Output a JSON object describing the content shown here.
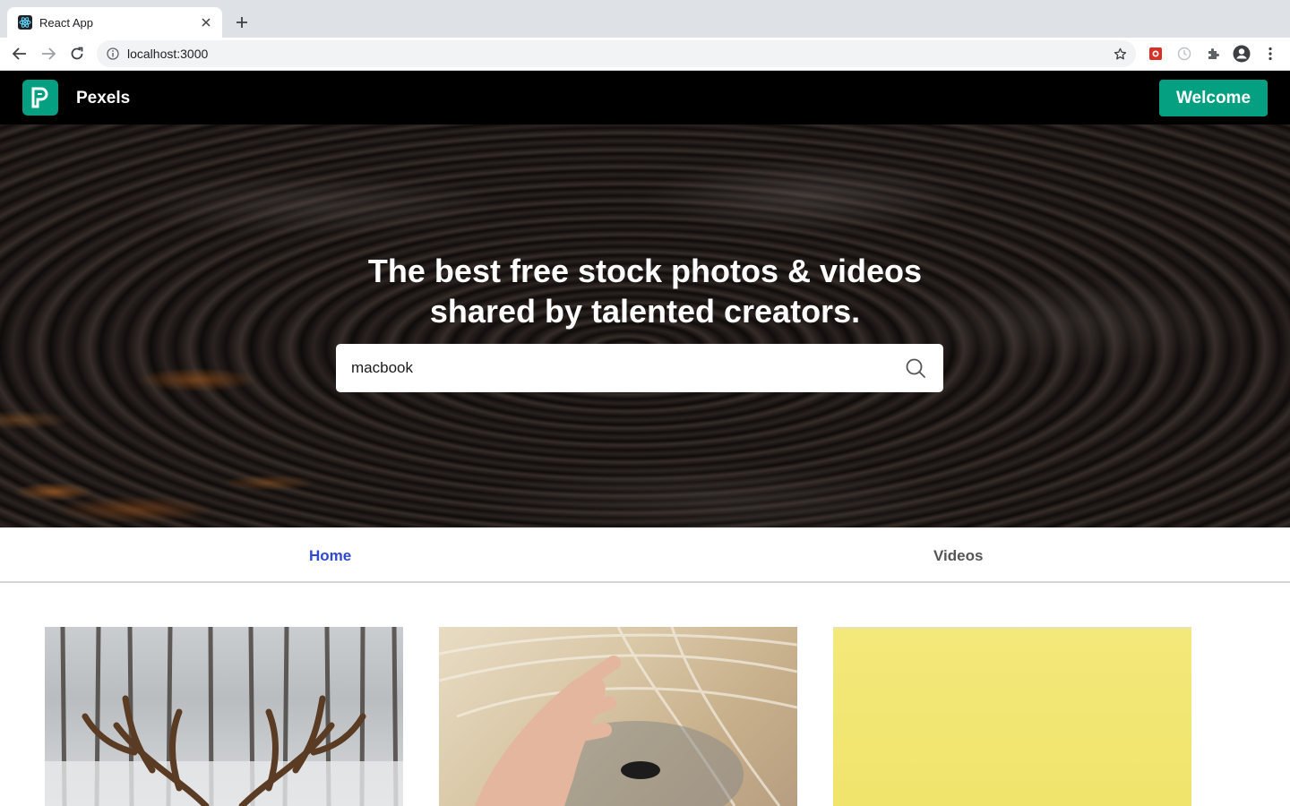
{
  "browser": {
    "tab_title": "React App",
    "url": "localhost:3000"
  },
  "app": {
    "brand": "Pexels",
    "logo_letter": "P",
    "welcome_label": "Welcome",
    "accent_color": "#05a081"
  },
  "hero": {
    "title_line1": "The best free stock photos & videos",
    "title_line2": "shared by talented creators.",
    "search_value": "macbook"
  },
  "tabs": {
    "home": "Home",
    "videos": "Videos",
    "active": "Home",
    "active_color": "#2f49d1"
  },
  "gallery": [
    {
      "subject": "deer antlers in snowy forest"
    },
    {
      "subject": "hand on white horse mane"
    },
    {
      "subject": "yellow background"
    }
  ]
}
